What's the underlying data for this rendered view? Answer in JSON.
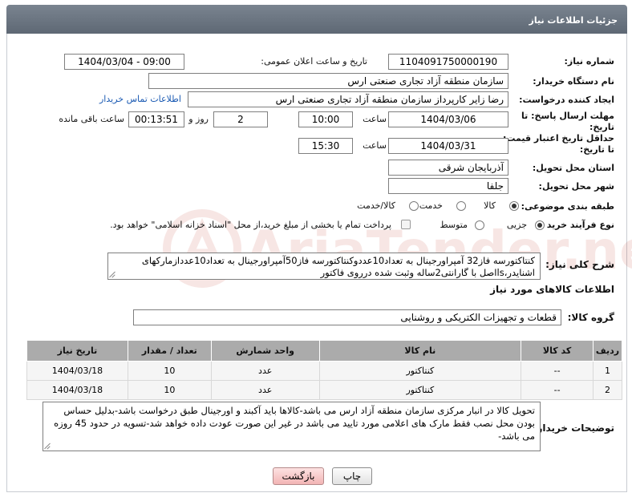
{
  "header": {
    "title": "جزئیات اطلاعات نیاز"
  },
  "fields": {
    "need_number_label": "شماره نیاز:",
    "need_number": "1104091750000190",
    "announce_label": "تاریخ و ساعت اعلان عمومی:",
    "announce_value": "1404/03/04 - 09:00",
    "buyer_org_label": "نام دستگاه خریدار:",
    "buyer_org": "سازمان منطقه آزاد تجاری صنعتی ارس",
    "requester_label": "ایجاد کننده درخواست:",
    "requester": "رضا زایر کارپرداز سازمان منطقه آزاد تجاری صنعتی ارس",
    "contact_link": "اطلاعات تماس خریدار",
    "deadline_label_1": "مهلت ارسال پاسخ: تا",
    "deadline_label_2": "تاریخ:",
    "deadline_date": "1404/03/06",
    "time_label": "ساعت",
    "deadline_time": "10:00",
    "days_value": "2",
    "days_label": "روز و",
    "remaining_time": "00:13:51",
    "remaining_label": "ساعت باقی مانده",
    "validity_label_1": "حداقل تاریخ اعتبار قیمت:",
    "validity_label_2": "تا تاریخ:",
    "validity_date": "1404/03/31",
    "validity_time_label": "ساعت",
    "validity_time": "15:30",
    "province_label": "استان محل تحویل:",
    "province": "آذربایجان شرقی",
    "city_label": "شهر محل تحویل:",
    "city": "جلفا",
    "category_label": "طبقه بندی موضوعی:",
    "category_options": [
      "کالا",
      "خدمت",
      "کالا/خدمت"
    ],
    "category_selected": "کالا",
    "process_label": "نوع فرآیند خرید :",
    "process_options": [
      "جزیی",
      "متوسط"
    ],
    "process_selected": "جزیی",
    "payment_note": "پرداخت تمام یا بخشی از مبلغ خرید،از محل \"اسناد خزانه اسلامی\" خواهد بود."
  },
  "description": {
    "label": "شرح کلی نیاز:",
    "text": "کنتاکتورسه فاز32 آمپراورجینال به تعداد10عددوکنتاکتورسه فاز50آمپراورجینال به تعداد10عددازمارکهای اشنایدر،lsاصل با گارانتی2ساله وثبت شده درروی فاکتور"
  },
  "goods_section": {
    "title": "اطلاعات کالاهای مورد نیاز",
    "group_label": "گروه کالا:",
    "group_value": "قطعات و تجهیزات الکتریکی و روشنایی"
  },
  "table": {
    "headers": [
      "ردیف",
      "کد کالا",
      "نام کالا",
      "واحد شمارش",
      "تعداد / مقدار",
      "تاریخ نیاز"
    ],
    "rows": [
      [
        "1",
        "--",
        "کنتاکتور",
        "عدد",
        "10",
        "1404/03/18"
      ],
      [
        "2",
        "--",
        "کنتاکتور",
        "عدد",
        "10",
        "1404/03/18"
      ]
    ]
  },
  "buyer_notes": {
    "label": "توضیحات خریدار:",
    "text": "تحویل کالا در انبار مرکزی سازمان منطقه آزاد ارس می باشد-کالاها باید آکبند و اورجینال طبق درخواست باشد-بدلیل حساس بودن محل نصب فقط مارک های اعلامی مورد تایید می باشد در غیر این صورت عودت داده خواهد شد-تسویه در حدود 45 روزه می باشد-"
  },
  "buttons": {
    "print": "چاپ",
    "back": "بازگشت"
  },
  "watermark": {
    "text": "AriaTender.neT"
  }
}
